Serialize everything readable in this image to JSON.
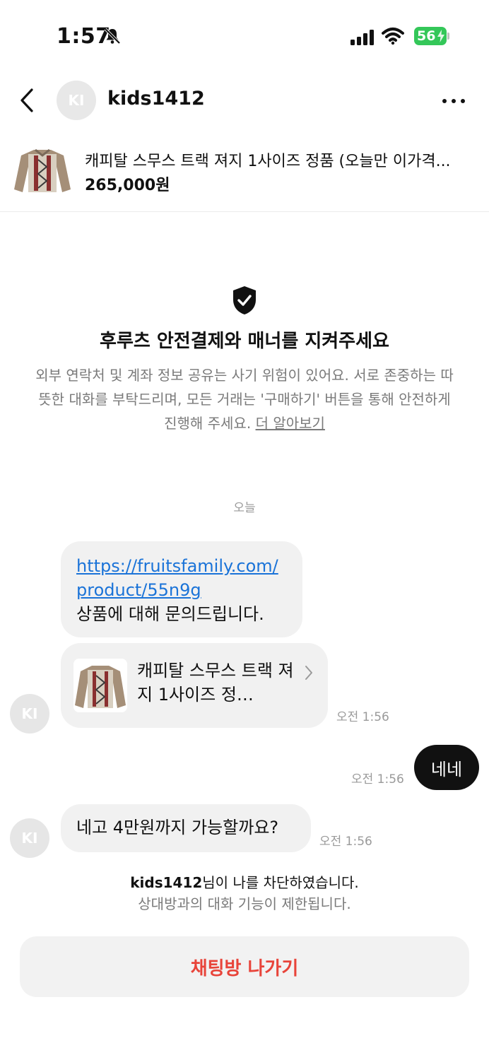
{
  "status_bar": {
    "time": "1:57",
    "battery": "56"
  },
  "header": {
    "avatar_initials": "KI",
    "username": "kids1412"
  },
  "product": {
    "title": "캐피탈 스무스 트랙 져지 1사이즈 정품 (오늘만 이가격...",
    "price": "265,000원"
  },
  "notice": {
    "title": "후루츠 안전결제와 매너를 지켜주세요",
    "body": "외부 연락처 및 계좌 정보 공유는 사기 위험이 있어요. 서로 존중하는 따뜻한 대화를 부탁드리며, 모든 거래는 '구매하기' 버튼을 통해 안전하게 진행해 주세요.",
    "link": "더 알아보기"
  },
  "date_separator": "오늘",
  "messages": {
    "first": {
      "link_line1": "https://fruitsfamily.com/",
      "link_line2": "product/55n9g",
      "text": "상품에 대해 문의드립니다."
    },
    "card": {
      "title": "캐피탈 스무스 트랙 져지 1사이즈 정…",
      "time": "오전 1:56",
      "avatar": "KI"
    },
    "outgoing": {
      "text": "네네",
      "time": "오전 1:56"
    },
    "second": {
      "text": "네고 4만원까지 가능할까요?",
      "time": "오전 1:56",
      "avatar": "KI"
    }
  },
  "blocked_notice": {
    "username": "kids1412",
    "line1_suffix": "님이 나를 차단하였습니다.",
    "line2": "상대방과의 대화 기능이 제한됩니다."
  },
  "leave_button": "채팅방 나가기",
  "colors": {
    "accent_red": "#e8443a",
    "link_blue": "#1a73d8",
    "battery_green": "#34c759"
  }
}
